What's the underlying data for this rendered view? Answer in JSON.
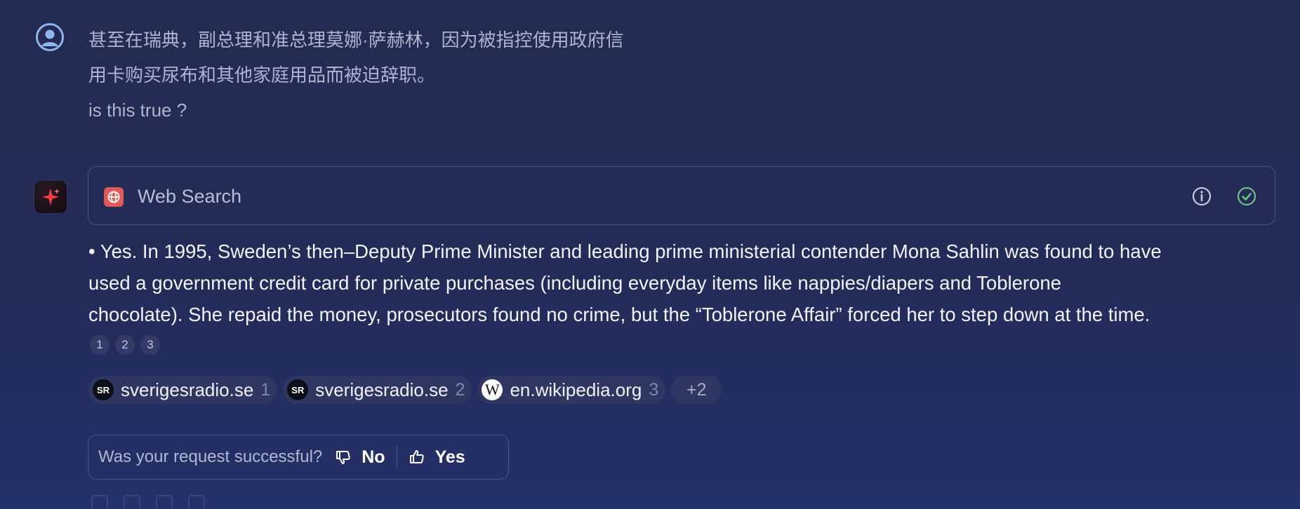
{
  "user_message": {
    "lines": [
      "甚至在瑞典，副总理和准总理莫娜·萨赫林，因为被指控使用政府信",
      "用卡购买尿布和其他家庭用品而被迫辞职。",
      "is this true ?"
    ]
  },
  "tool_call": {
    "label": "Web Search",
    "icon": "globe-icon",
    "status": "completed"
  },
  "answer": {
    "lines": [
      "• Yes. In 1995, Sweden’s then–Deputy Prime Minister and leading prime ministerial contender Mona Sahlin was found to have",
      "used a government credit card for private purchases (including everyday items like nappies/diapers and Toblerone",
      "chocolate). She repaid the money, prosecutors found no crime, but the “Toblerone Affair” forced her to step down at the time."
    ],
    "citations": [
      "1",
      "2",
      "3"
    ]
  },
  "sources": [
    {
      "favicon": "SR",
      "name": "sverigesradio.se",
      "num": "1"
    },
    {
      "favicon": "SR",
      "name": "sverigesradio.se",
      "num": "2"
    },
    {
      "favicon": "W",
      "name": "en.wikipedia.org",
      "num": "3"
    }
  ],
  "more_sources": "+2",
  "feedback": {
    "question": "Was your request successful?",
    "no_label": "No",
    "yes_label": "Yes"
  },
  "colors": {
    "background": "#242b52",
    "border": "#4a5387",
    "search_icon_bg": "#e25a57",
    "check_green": "#6cc28a",
    "user_avatar": "#8bb6f0"
  }
}
